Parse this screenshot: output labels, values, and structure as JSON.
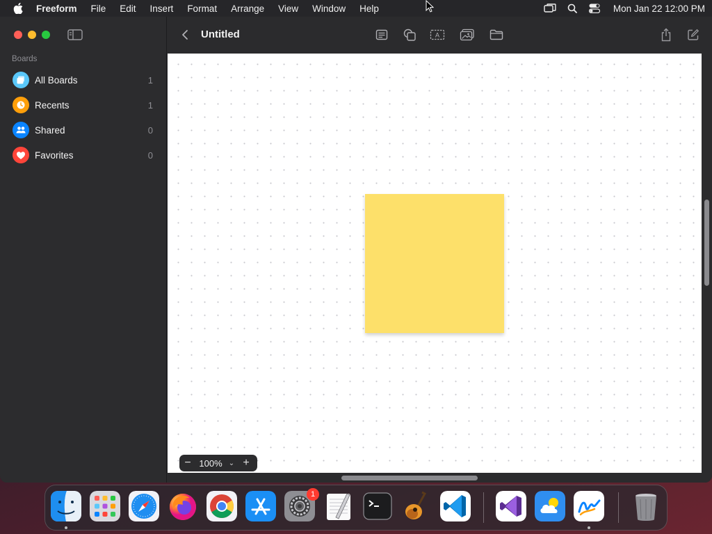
{
  "menubar": {
    "app_name": "Freeform",
    "items": [
      "File",
      "Edit",
      "Insert",
      "Format",
      "Arrange",
      "View",
      "Window",
      "Help"
    ],
    "clock": "Mon Jan 22  12:00 PM"
  },
  "sidebar": {
    "section_title": "Boards",
    "items": [
      {
        "label": "All Boards",
        "count": "1",
        "color": "#5ac8fa"
      },
      {
        "label": "Recents",
        "count": "1",
        "color": "#ff9f0a"
      },
      {
        "label": "Shared",
        "count": "0",
        "color": "#0a84ff"
      },
      {
        "label": "Favorites",
        "count": "0",
        "color": "#ff453a"
      }
    ]
  },
  "toolbar": {
    "title": "Untitled",
    "icons": [
      "sticky-note-icon",
      "shapes-icon",
      "text-box-icon",
      "media-icon",
      "file-icon",
      "share-icon",
      "compose-icon"
    ]
  },
  "canvas": {
    "sticky_note_color": "#fde06a",
    "background": "#ffffff"
  },
  "zoom": {
    "minus": "−",
    "value": "100%",
    "dropdown": "⌄",
    "plus": "+"
  },
  "dock": {
    "apps": [
      "Finder",
      "Launchpad",
      "Safari",
      "Firefox",
      "Chrome",
      "App Store",
      "System Settings",
      "TextEdit",
      "Terminal",
      "GarageBand",
      "VS Code",
      "Visual Studio",
      "Weather",
      "Freeform",
      "Trash"
    ],
    "settings_badge": "1"
  }
}
